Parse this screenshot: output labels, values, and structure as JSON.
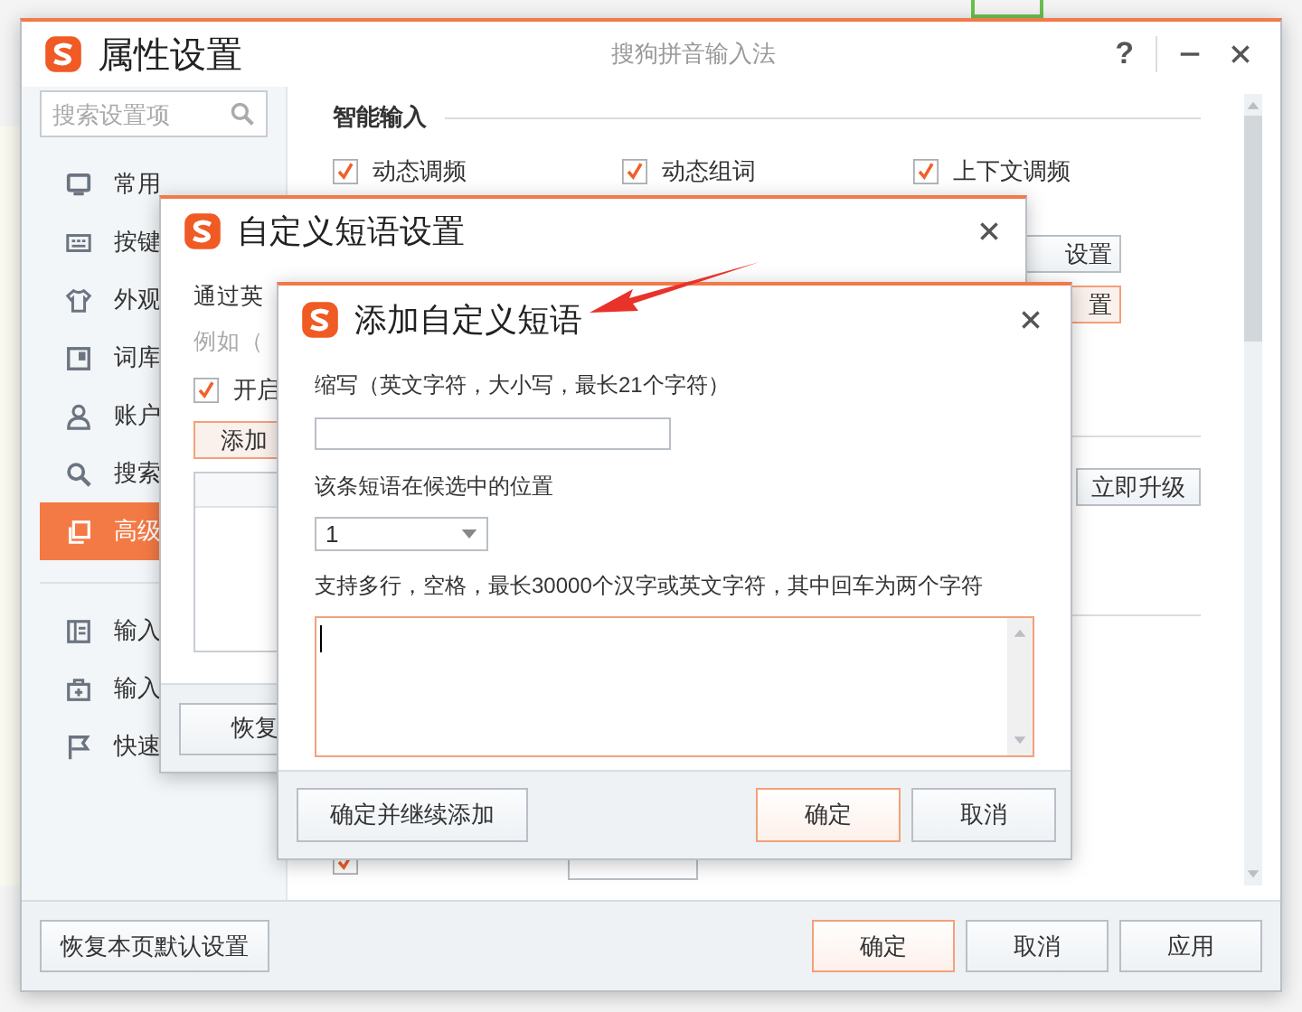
{
  "main_window": {
    "title": "属性设置",
    "subtitle": "搜狗拼音输入法",
    "help": "?",
    "search": {
      "placeholder": "搜索设置项"
    },
    "sidebar": {
      "items": [
        {
          "label": "常用",
          "selected": false
        },
        {
          "label": "按键",
          "selected": false
        },
        {
          "label": "外观",
          "selected": false
        },
        {
          "label": "词库",
          "selected": false
        },
        {
          "label": "账户",
          "selected": false
        },
        {
          "label": "搜索",
          "selected": false
        },
        {
          "label": "高级",
          "selected": true
        }
      ],
      "tools": [
        {
          "label": "输入"
        },
        {
          "label": "输入"
        },
        {
          "label": "快速"
        }
      ]
    },
    "section_title": "智能输入",
    "options": [
      {
        "label": "动态调频",
        "checked": true
      },
      {
        "label": "动态组词",
        "checked": true
      },
      {
        "label": "上下文调频",
        "checked": true
      }
    ],
    "side_buttons": [
      {
        "label": "设置",
        "highlighted": false
      },
      {
        "label": "置",
        "highlighted": true
      }
    ],
    "upgrade_button": "立即升级",
    "emoji_option": {
      "checked": true
    },
    "footer": {
      "restore": "恢复本页默认设置",
      "buttons": [
        {
          "label": "确定",
          "primary": true
        },
        {
          "label": "取消",
          "primary": false
        },
        {
          "label": "应用",
          "primary": false
        }
      ]
    }
  },
  "phrase_settings": {
    "title": "自定义短语设置",
    "intro": "通过英",
    "example": "例如（",
    "enable": {
      "label": "开启",
      "checked": true
    },
    "add_button": "添加",
    "restore_button": "恢复"
  },
  "add_phrase": {
    "title": "添加自定义短语",
    "abbr_label": "缩写（英文字符，大小写，最长21个字符）",
    "position_label": "该条短语在候选中的位置",
    "position_value": "1",
    "content_label": "支持多行，空格，最长30000个汉字或英文字符，其中回车为两个字符",
    "buttons": [
      {
        "label": "确定并继续添加",
        "primary": false
      },
      {
        "label": "确定",
        "primary": true
      },
      {
        "label": "取消",
        "primary": false
      }
    ]
  }
}
